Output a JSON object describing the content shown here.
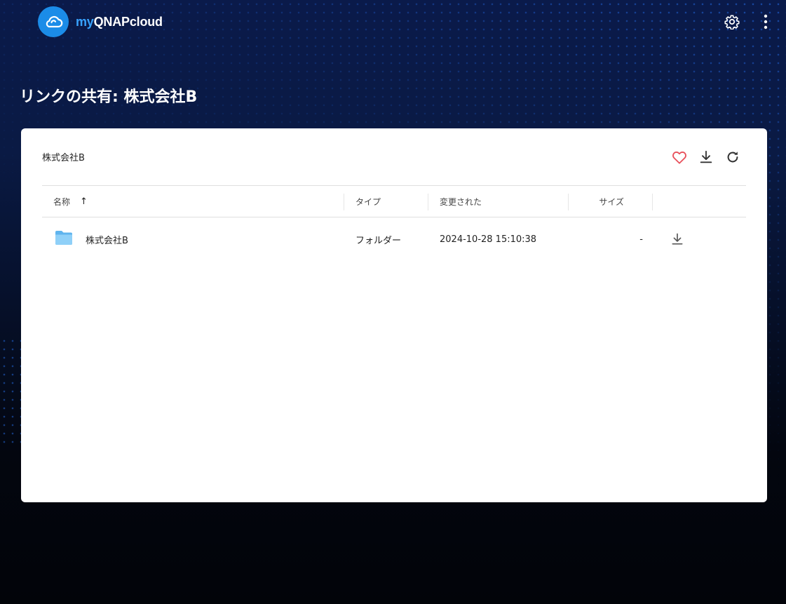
{
  "app": {
    "brand_prefix": "my",
    "brand_suffix": "QNAPcloud",
    "accent_color": "#1b8ce8"
  },
  "topbar": {
    "apps_icon": "grid-icon",
    "settings_icon": "gear-icon",
    "more_icon": "more-vertical-icon"
  },
  "page": {
    "title": "リンクの共有: 株式会社B"
  },
  "card": {
    "folder_name": "株式会社B",
    "actions": {
      "favorite_icon": "heart-icon",
      "favorite_color": "#e8505b",
      "download_icon": "download-icon",
      "refresh_icon": "refresh-icon"
    }
  },
  "table": {
    "columns": {
      "name": "名称",
      "type": "タイプ",
      "modified": "変更された",
      "size": "サイズ"
    },
    "sort": {
      "column": "name",
      "direction": "ascending"
    },
    "rows": [
      {
        "icon": "folder-icon",
        "name": "株式会社B",
        "type": "フォルダー",
        "modified": "2024-10-28 15:10:38",
        "size": "-"
      }
    ]
  }
}
